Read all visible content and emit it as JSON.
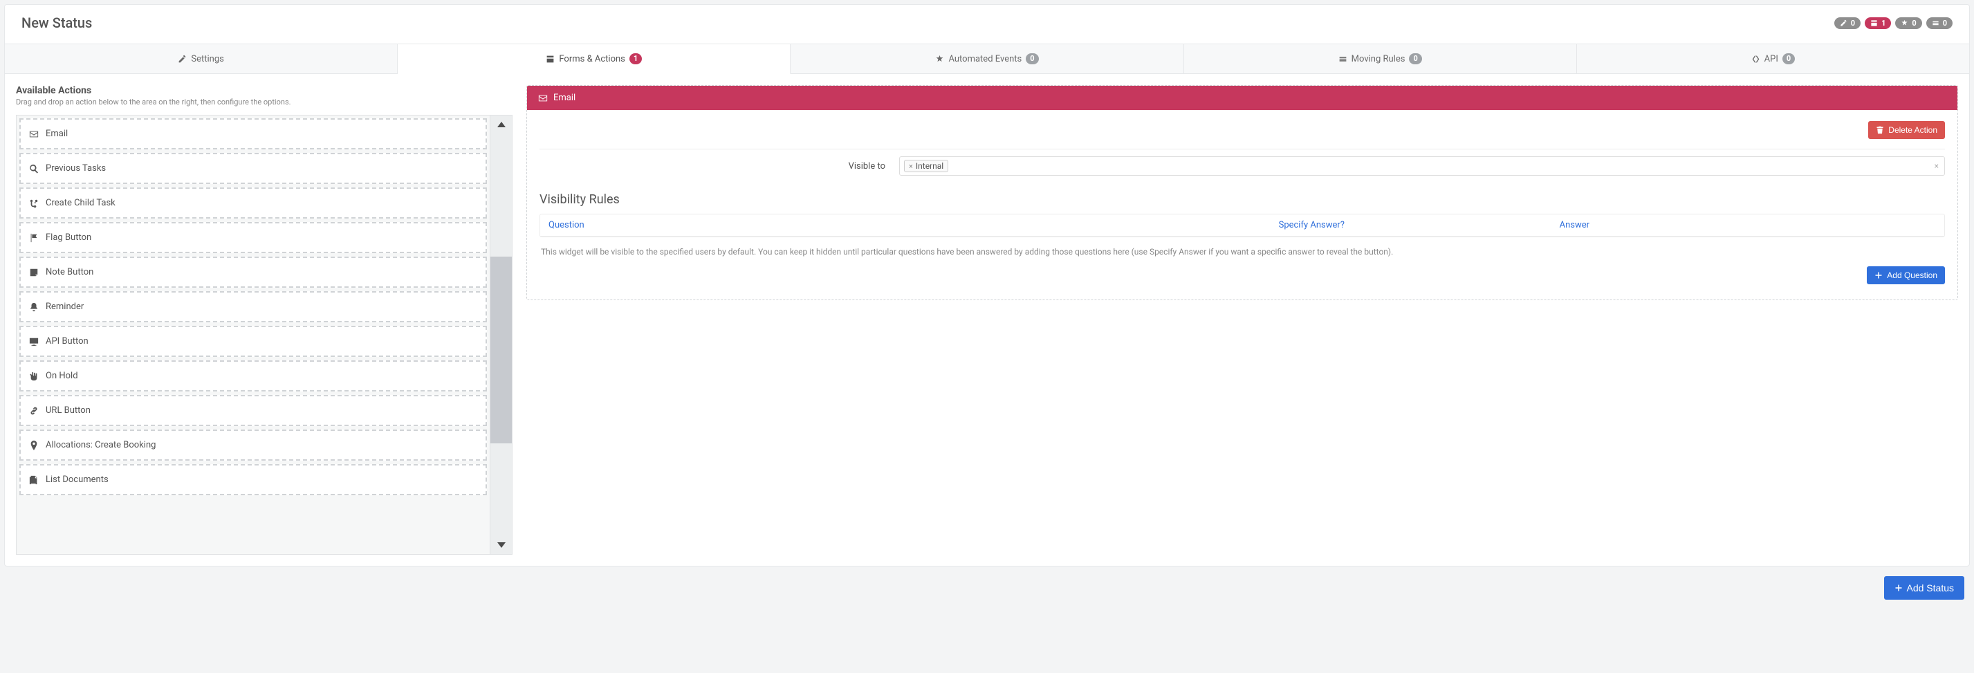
{
  "header": {
    "title": "New Status",
    "badges": [
      {
        "icon": "edit",
        "count": 0,
        "color": "grey"
      },
      {
        "icon": "form",
        "count": 1,
        "color": "red"
      },
      {
        "icon": "automation",
        "count": 0,
        "color": "grey"
      },
      {
        "icon": "moving",
        "count": 0,
        "color": "grey"
      }
    ]
  },
  "tabs": {
    "settings": {
      "label": "Settings"
    },
    "forms": {
      "label": "Forms & Actions",
      "count": 1,
      "count_color": "red"
    },
    "auto": {
      "label": "Automated Events",
      "count": 0
    },
    "moving": {
      "label": "Moving Rules",
      "count": 0
    },
    "api": {
      "label": "API",
      "count": 0
    }
  },
  "sidebar": {
    "title": "Available Actions",
    "hint": "Drag and drop an action below to the area on the right, then configure the options.",
    "items": [
      {
        "icon": "mail",
        "label": "Email"
      },
      {
        "icon": "search",
        "label": "Previous Tasks"
      },
      {
        "icon": "branch",
        "label": "Create Child Task"
      },
      {
        "icon": "flag",
        "label": "Flag Button"
      },
      {
        "icon": "note",
        "label": "Note Button"
      },
      {
        "icon": "bell",
        "label": "Reminder"
      },
      {
        "icon": "monitor",
        "label": "API Button"
      },
      {
        "icon": "hand",
        "label": "On Hold"
      },
      {
        "icon": "link",
        "label": "URL Button"
      },
      {
        "icon": "pin",
        "label": "Allocations: Create Booking"
      },
      {
        "icon": "docs",
        "label": "List Documents"
      }
    ]
  },
  "action_panel": {
    "title": "Email",
    "delete_label": "Delete Action",
    "visible_to_label": "Visible to",
    "visible_to_tag": "Internal",
    "visibility_rules_title": "Visibility Rules",
    "columns": {
      "question": "Question",
      "specify": "Specify Answer?",
      "answer": "Answer"
    },
    "note": "This widget will be visible to the specified users by default. You can keep it hidden until particular questions have been answered by adding those questions here (use Specify Answer if you want a specific answer to reveal the button).",
    "add_question_label": "Add Question"
  },
  "footer": {
    "add_status_label": "Add Status"
  }
}
